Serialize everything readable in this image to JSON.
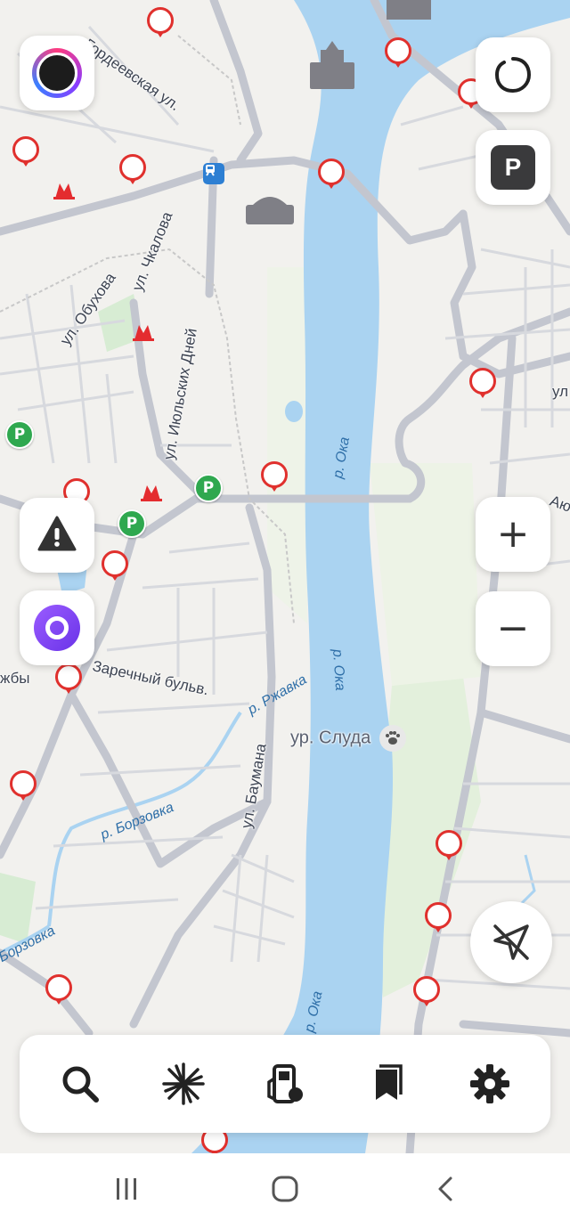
{
  "map": {
    "streets": {
      "gordeevskaya": "Гордеевская ул.",
      "chkalova": "ул. Чкалова",
      "obukhova": "ул. Обухова",
      "iyulskikh_dney": "ул. Июльских Дней",
      "zarechny": "Заречный бульв.",
      "baumana": "ул. Баумана",
      "druzhby_partial": "жбы",
      "right_edge_ul": "ул",
      "right_edge_ayu": "Аю"
    },
    "rivers": {
      "oka_upper": "р. Ока",
      "oka_middle": "р. Ока",
      "oka_lower": "р. Ока",
      "rzhavka": "р. Ржавка",
      "borzovka": "р. Борзовка",
      "borzovka_left": "Борзовка"
    },
    "places": {
      "sluda": "ур. Слуда"
    }
  },
  "controls": {
    "parking": "P",
    "zoom_in": "+",
    "zoom_out": "−"
  },
  "icons": {
    "profile": "profile-avatar-icon",
    "voice_search": "voice-search-icon",
    "parking": "parking-icon",
    "road_alert": "road-event-warning-icon",
    "alice": "alice-assistant-icon",
    "compass": "location-arrow-off-icon",
    "toolbar": [
      "search-icon",
      "discovery-icon",
      "gas-station-icon",
      "bookmarks-icon",
      "settings-icon"
    ],
    "navbar": [
      "recent-apps-icon",
      "home-icon",
      "back-icon"
    ]
  },
  "colors": {
    "water": "#aad3f1",
    "road": "#c3c6cf",
    "camera": "#e0302d",
    "gas_station": "#2fa84f",
    "alice": "#7b46f5",
    "metro": "#e42c2f"
  }
}
